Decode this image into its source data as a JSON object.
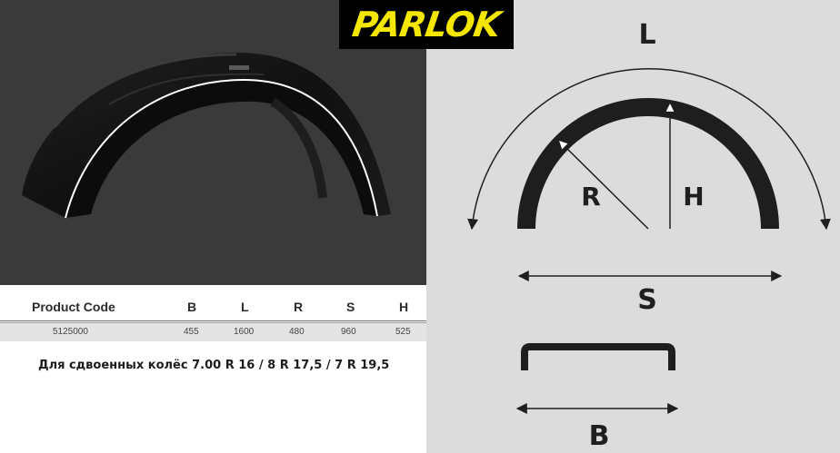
{
  "brand": {
    "logo_text": "PARLOK"
  },
  "table": {
    "headers": [
      "Product Code",
      "B",
      "L",
      "R",
      "S",
      "H"
    ],
    "row": [
      "5125000",
      "455",
      "1600",
      "480",
      "960",
      "525"
    ]
  },
  "note": "Для сдвоенных колёс 7.00 R 16 / 8 R 17,5 /  7 R 19,5",
  "diagram": {
    "labels": {
      "L": "L",
      "R": "R",
      "H": "H",
      "S": "S",
      "B": "B"
    }
  },
  "colors": {
    "logo_bg": "#000000",
    "logo_text": "#f5e600",
    "photo_bg": "#3a3a3a",
    "diagram_bg": "#dcdcdc"
  }
}
